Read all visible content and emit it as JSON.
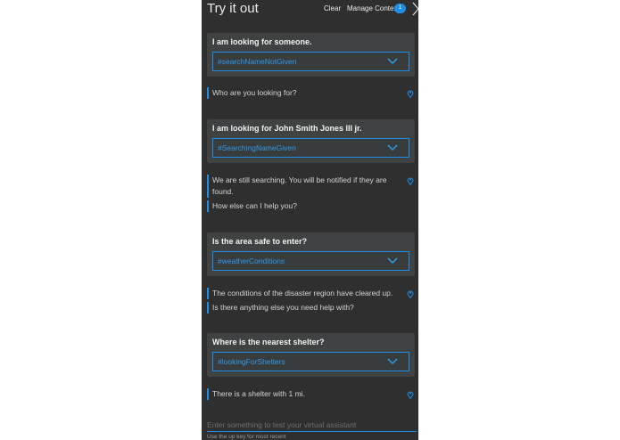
{
  "header": {
    "title": "Try it out",
    "clear_label": "Clear",
    "manage_context_label": "Manage Context",
    "context_count": "1"
  },
  "conversation": [
    {
      "question": "I am looking for someone.",
      "intent": "#searchNameNotGiven",
      "responses": [
        "Who are you looking for?"
      ]
    },
    {
      "question": "I am looking for John Smith Jones III jr.",
      "intent": "#SearchingNameGiven",
      "responses": [
        "We are still searching. You will be notified if they are found.",
        "How else can I help you?"
      ]
    },
    {
      "question": "Is the area safe to enter?",
      "intent": "#weatherConditions",
      "responses": [
        "The conditions of the disaster region have cleared up.",
        "Is there anything else you need help with?"
      ]
    },
    {
      "question": "Where is the nearest shelter?",
      "intent": "#lookingForShelters",
      "responses": [
        "There is a shelter with 1 mi."
      ]
    }
  ],
  "input": {
    "placeholder": "Enter something to test your virtual assistant",
    "hint": "Use the up key for most recent"
  },
  "colors": {
    "accent": "#1e8ee8",
    "panel_bg": "#2f2f2f",
    "card_bg": "#3f4242"
  }
}
